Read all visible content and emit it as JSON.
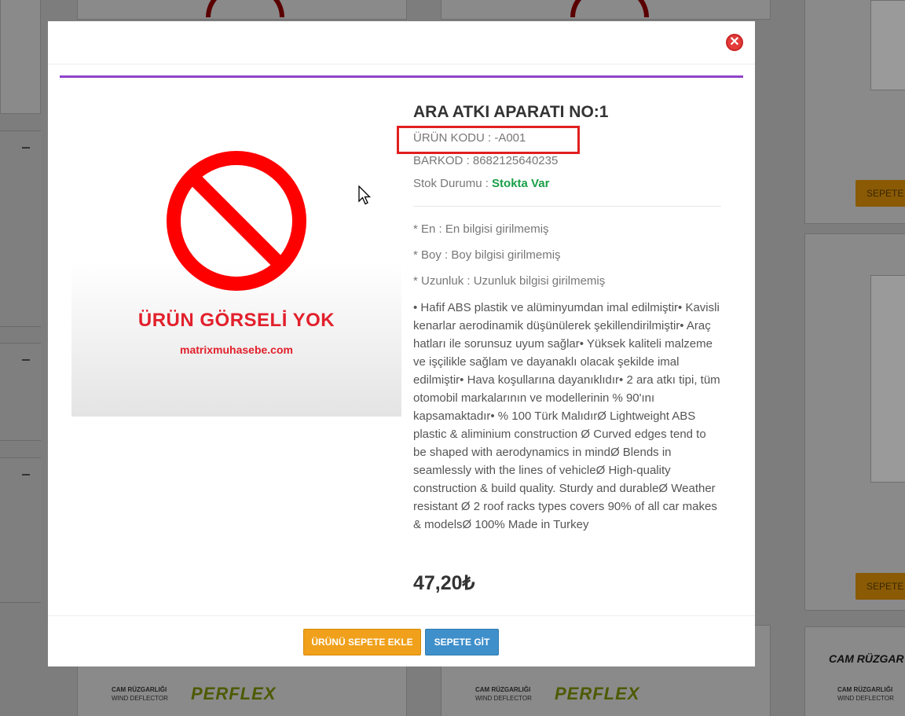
{
  "background": {
    "buttons": [
      "SEPETE",
      "SEPETE"
    ],
    "ad_labels": [
      "CAM RÜZGARLIĞI",
      "WIND DEFLECTOR"
    ],
    "brand": "PERFLEX",
    "product_caption": "CAM RÜZGAR",
    "collapse_symbol": "−"
  },
  "modal": {
    "close_symbol": "✕",
    "image": {
      "title": "ÜRÜN GÖRSELİ YOK",
      "site": "matrixmuhasebe.com"
    },
    "product": {
      "title": "ARA ATKI APARATI NO:1",
      "code_label": "ÜRÜN KODU :",
      "code_value": "-A001",
      "barcode_label": "BARKOD :",
      "barcode_value": "8682125640235",
      "stock_label": "Stok Durumu :",
      "stock_value": "Stokta Var",
      "specs": [
        "* En : En bilgisi girilmemiş",
        "* Boy : Boy bilgisi girilmemiş",
        "* Uzunluk : Uzunluk bilgisi girilmemiş"
      ],
      "description": "• Hafif ABS plastik ve alüminyumdan imal edilmiştir• Kavisli kenarlar aerodinamik düşünülerek şekillendirilmiştir• Araç hatları ile sorunsuz uyum sağlar• Yüksek kaliteli malzeme ve işçilikle sağlam ve dayanaklı olacak şekilde imal edilmiştir• Hava koşullarına dayanıklıdır• 2 ara atkı tipi, tüm otomobil markalarının ve modellerinin % 90'ını kapsamaktadır• % 100 Türk MalıdırØ  Lightweight ABS plastic & aliminium construction Ø  Curved edges tend to be shaped with aerodynamics in mindØ  Blends in seamlessly with the lines of vehicleØ  High-quality construction & build quality. Sturdy and durableØ  Weather resistant Ø  2 roof racks types covers 90% of all car makes & modelsØ  100% Made in Turkey",
      "price": "47,20₺"
    },
    "footer": {
      "add_to_cart": "ÜRÜNÜ SEPETE EKLE",
      "go_to_cart": "SEPETE GİT"
    }
  },
  "colors": {
    "accent_line": "#8e44c9",
    "stock_ok": "#1a9f48",
    "add_button": "#f0a01a",
    "cart_button": "#3f8fca",
    "no_image_red": "#e2202c"
  }
}
